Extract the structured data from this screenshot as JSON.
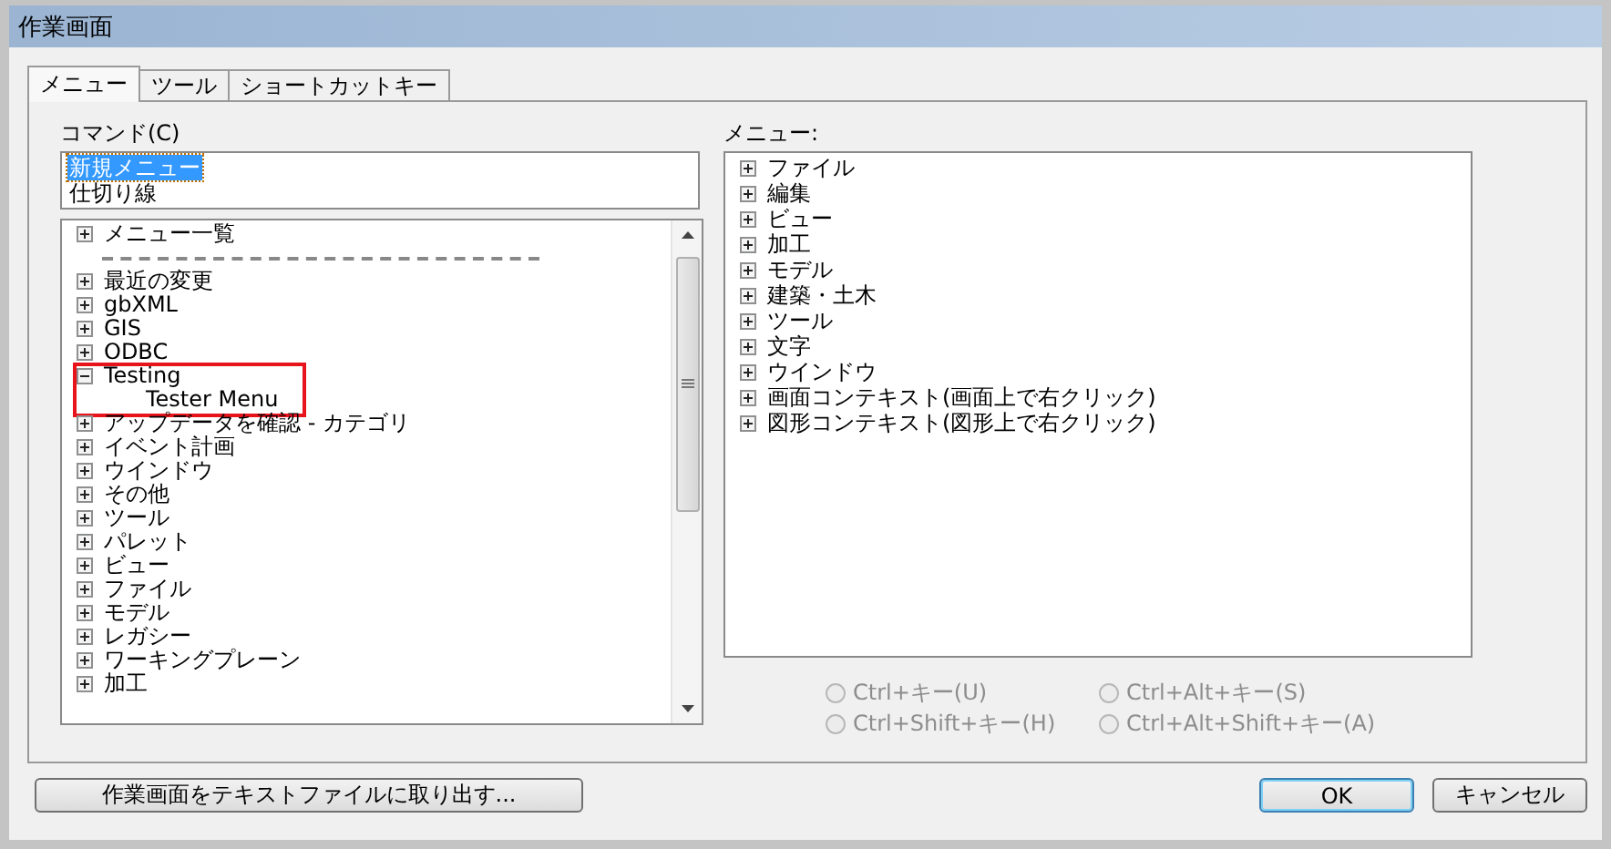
{
  "window": {
    "title": "作業画面"
  },
  "tabs": [
    {
      "label": "メニュー",
      "selected": true
    },
    {
      "label": "ツール",
      "selected": false
    },
    {
      "label": "ショートカットキー",
      "selected": false
    }
  ],
  "command_label": "コマンド(C)",
  "commands": [
    {
      "label": "新規メニュー",
      "selected": true
    },
    {
      "label": "仕切り線",
      "selected": false
    }
  ],
  "command_tree": [
    {
      "kind": "node",
      "label": "メニュー一覧",
      "expanded": false
    },
    {
      "kind": "separator"
    },
    {
      "kind": "node",
      "label": "最近の変更",
      "expanded": false
    },
    {
      "kind": "node",
      "label": "gbXML",
      "expanded": false
    },
    {
      "kind": "node",
      "label": "GIS",
      "expanded": false
    },
    {
      "kind": "node",
      "label": "ODBC",
      "expanded": false
    },
    {
      "kind": "node",
      "label": "Testing",
      "expanded": true,
      "highlighted": true,
      "children": [
        {
          "kind": "leaf",
          "label": "Tester Menu"
        }
      ]
    },
    {
      "kind": "node",
      "label": "アップデータを確認 - カテゴリ",
      "expanded": false
    },
    {
      "kind": "node",
      "label": "イベント計画",
      "expanded": false
    },
    {
      "kind": "node",
      "label": "ウインドウ",
      "expanded": false
    },
    {
      "kind": "node",
      "label": "その他",
      "expanded": false
    },
    {
      "kind": "node",
      "label": "ツール",
      "expanded": false
    },
    {
      "kind": "node",
      "label": "パレット",
      "expanded": false
    },
    {
      "kind": "node",
      "label": "ビュー",
      "expanded": false
    },
    {
      "kind": "node",
      "label": "ファイル",
      "expanded": false
    },
    {
      "kind": "node",
      "label": "モデル",
      "expanded": false
    },
    {
      "kind": "node",
      "label": "レガシー",
      "expanded": false
    },
    {
      "kind": "node",
      "label": "ワーキングプレーン",
      "expanded": false
    },
    {
      "kind": "node",
      "label": "加工",
      "expanded": false
    }
  ],
  "menu_label": "メニュー:",
  "menu_tree": [
    {
      "kind": "node",
      "label": "ファイル",
      "expanded": false
    },
    {
      "kind": "node",
      "label": "編集",
      "expanded": false
    },
    {
      "kind": "node",
      "label": "ビュー",
      "expanded": false
    },
    {
      "kind": "node",
      "label": "加工",
      "expanded": false
    },
    {
      "kind": "node",
      "label": "モデル",
      "expanded": false
    },
    {
      "kind": "node",
      "label": "建築・土木",
      "expanded": false
    },
    {
      "kind": "node",
      "label": "ツール",
      "expanded": false
    },
    {
      "kind": "node",
      "label": "文字",
      "expanded": false
    },
    {
      "kind": "node",
      "label": "ウインドウ",
      "expanded": false
    },
    {
      "kind": "node",
      "label": "画面コンテキスト(画面上で右クリック)",
      "expanded": false
    },
    {
      "kind": "node",
      "label": "図形コンテキスト(図形上で右クリック)",
      "expanded": false
    }
  ],
  "shortcut_options": [
    {
      "label": "Ctrl+キー(U)",
      "checked": false,
      "disabled": true
    },
    {
      "label": "Ctrl+Alt+キー(S)",
      "checked": false,
      "disabled": true
    },
    {
      "label": "Ctrl+Shift+キー(H)",
      "checked": false,
      "disabled": true
    },
    {
      "label": "Ctrl+Alt+Shift+キー(A)",
      "checked": false,
      "disabled": true
    }
  ],
  "export_button": "作業画面をテキストファイルに取り出す...",
  "buttons": [
    {
      "label": "OK",
      "default": true
    },
    {
      "label": "キャンセル",
      "default": false
    }
  ]
}
